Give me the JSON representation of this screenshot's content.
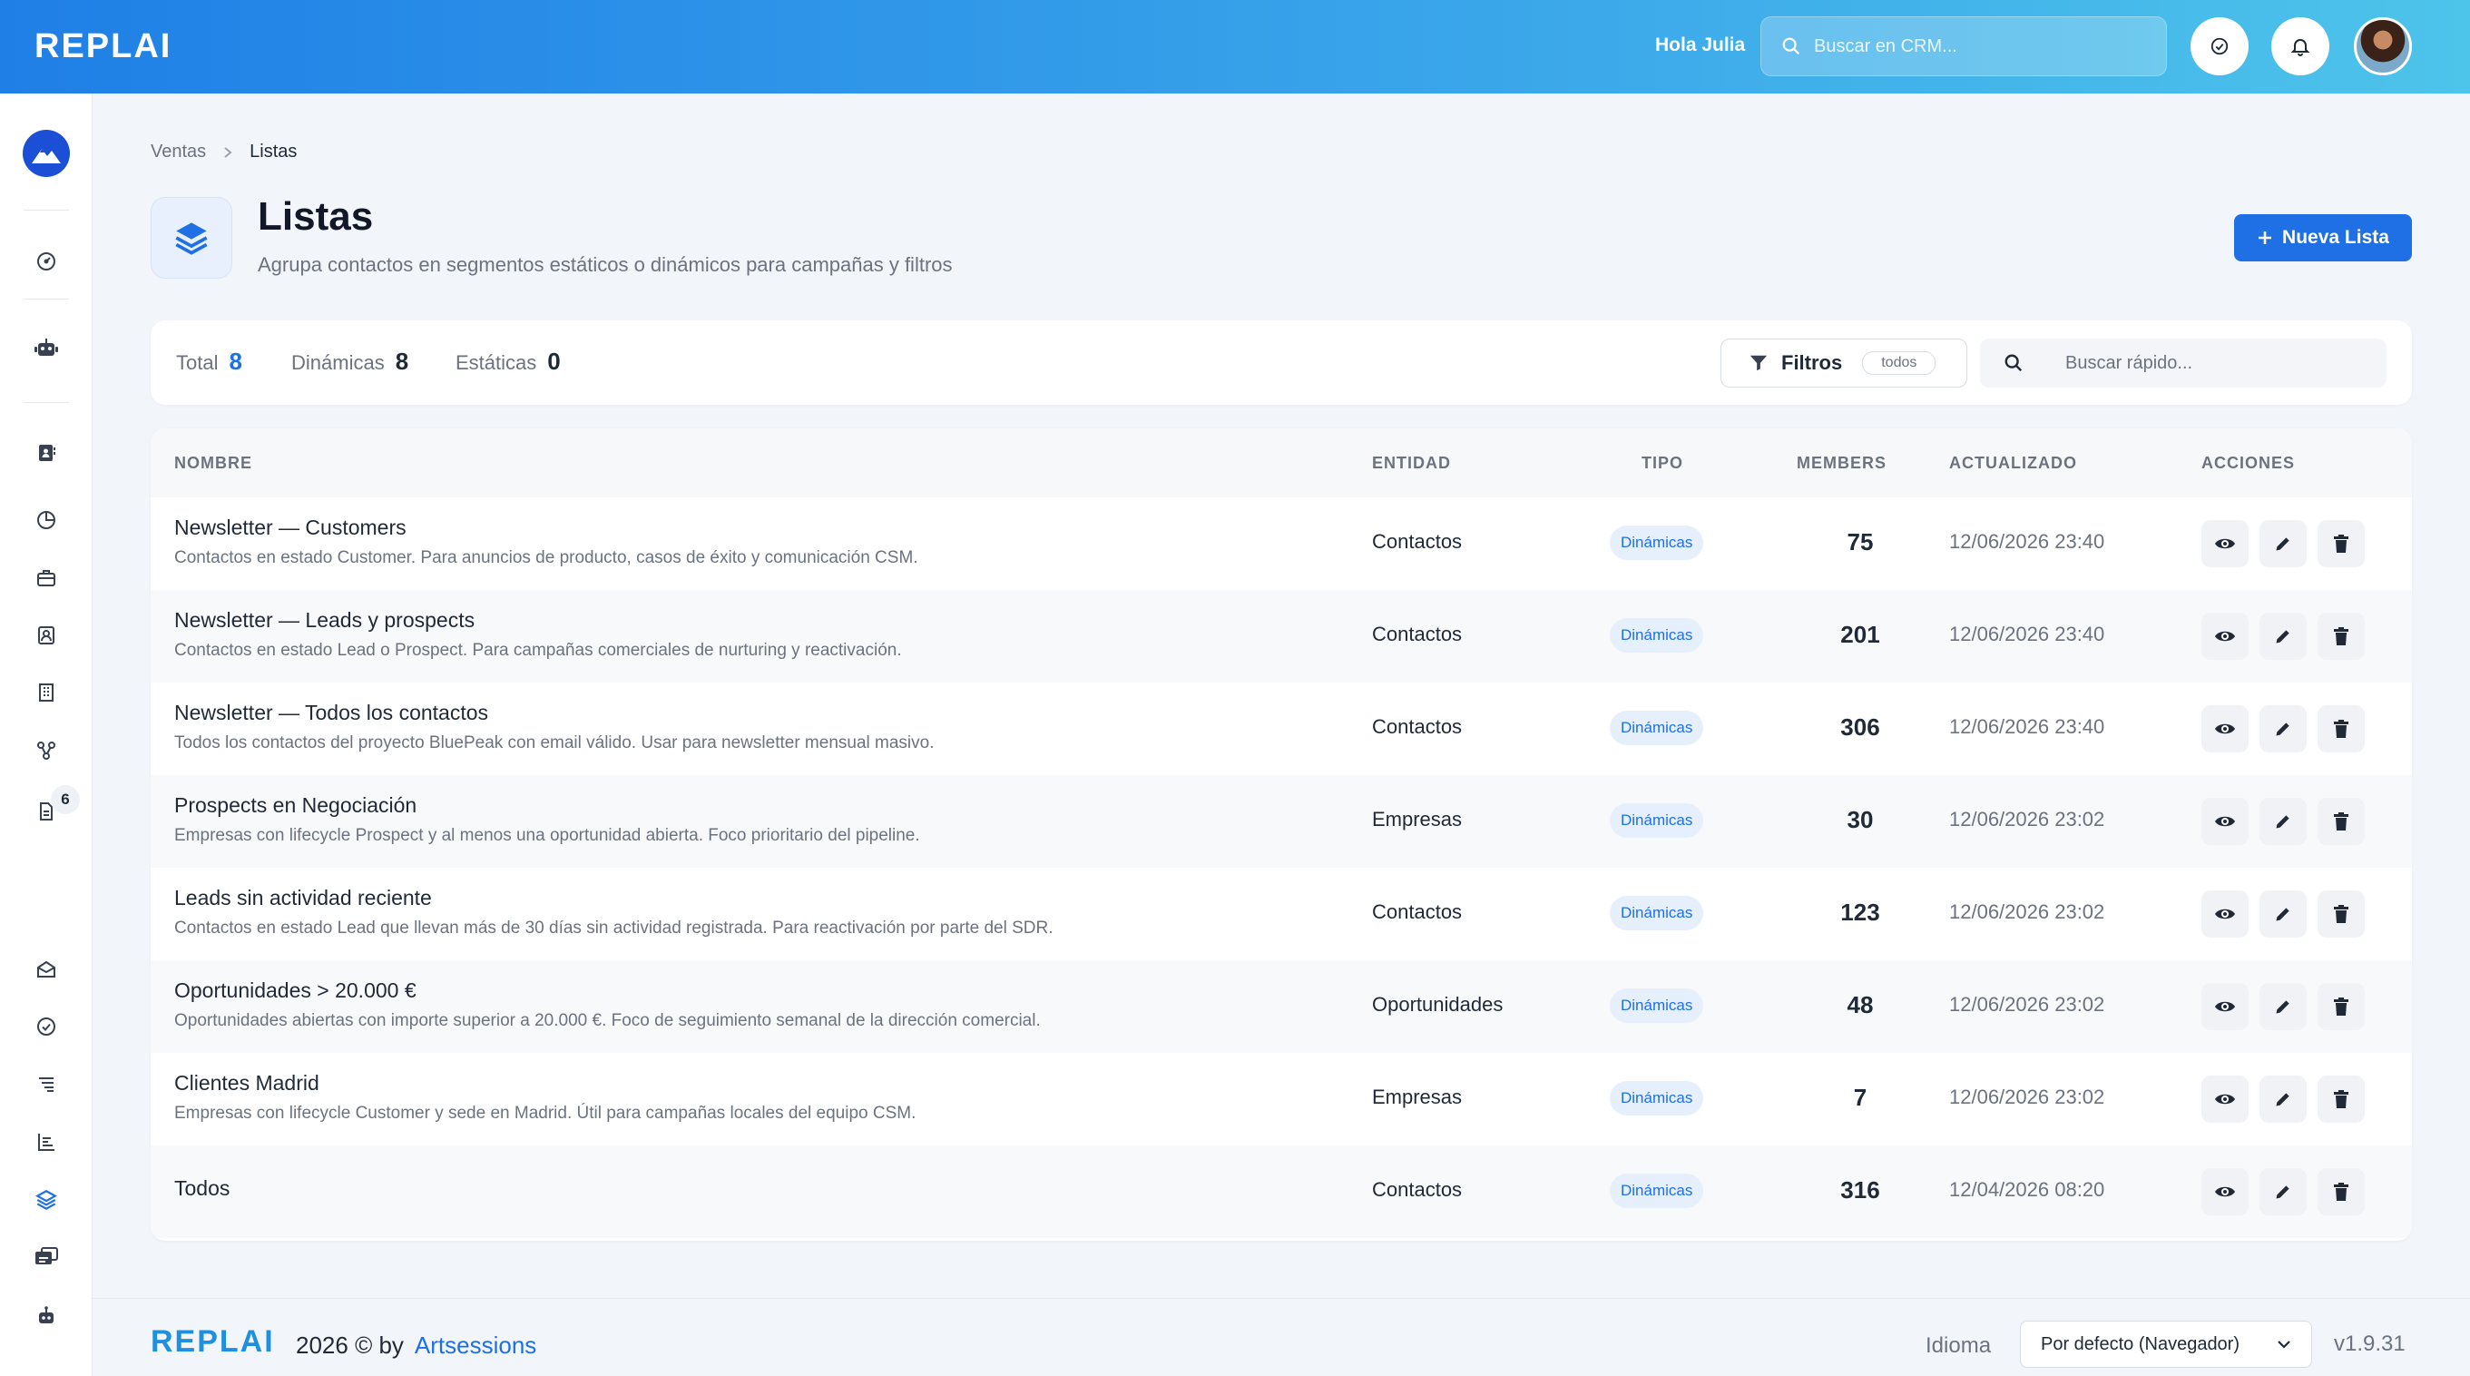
{
  "app": {
    "logo": "REPLAI",
    "greeting": "Hola Julia",
    "search_placeholder": "Buscar en CRM..."
  },
  "sidebar": {
    "badge": "6",
    "icons": [
      "dashboard-icon",
      "robot-icon",
      "contacts-book-icon",
      "pie-chart-icon",
      "briefcase-icon",
      "contact-card-icon",
      "building-icon",
      "flow-icon",
      "document-icon",
      "envelope-open-icon",
      "check-circle-icon",
      "list-icon",
      "bar-list-icon",
      "layers-icon",
      "inbox-cards-icon",
      "bot-icon"
    ]
  },
  "breadcrumb": {
    "parent": "Ventas",
    "current": "Listas"
  },
  "page": {
    "title": "Listas",
    "subtitle": "Agrupa contactos en segmentos estáticos o dinámicos para campañas y filtros",
    "new_button": "Nueva Lista"
  },
  "stats": {
    "total_label": "Total",
    "total": "8",
    "dyn_label": "Dinámicas",
    "dyn": "8",
    "static_label": "Estáticas",
    "static": "0"
  },
  "filters": {
    "label": "Filtros",
    "pill": "todos",
    "quick_placeholder": "Buscar rápido..."
  },
  "table": {
    "headers": {
      "name": "NOMBRE",
      "entity": "ENTIDAD",
      "type": "TIPO",
      "members": "MEMBERS",
      "updated": "ACTUALIZADO",
      "actions": "ACCIONES"
    },
    "rows": [
      {
        "name": "Newsletter — Customers",
        "desc": "Contactos en estado Customer. Para anuncios de producto, casos de éxito y comunicación CSM.",
        "entity": "Contactos",
        "type": "Dinámicas",
        "members": "75",
        "updated": "12/06/2026 23:40"
      },
      {
        "name": "Newsletter — Leads y prospects",
        "desc": "Contactos en estado Lead o Prospect. Para campañas comerciales de nurturing y reactivación.",
        "entity": "Contactos",
        "type": "Dinámicas",
        "members": "201",
        "updated": "12/06/2026 23:40"
      },
      {
        "name": "Newsletter — Todos los contactos",
        "desc": "Todos los contactos del proyecto BluePeak con email válido. Usar para newsletter mensual masivo.",
        "entity": "Contactos",
        "type": "Dinámicas",
        "members": "306",
        "updated": "12/06/2026 23:40"
      },
      {
        "name": "Prospects en Negociación",
        "desc": "Empresas con lifecycle Prospect y al menos una oportunidad abierta. Foco prioritario del pipeline.",
        "entity": "Empresas",
        "type": "Dinámicas",
        "members": "30",
        "updated": "12/06/2026 23:02"
      },
      {
        "name": "Leads sin actividad reciente",
        "desc": "Contactos en estado Lead que llevan más de 30 días sin actividad registrada. Para reactivación por parte del SDR.",
        "entity": "Contactos",
        "type": "Dinámicas",
        "members": "123",
        "updated": "12/06/2026 23:02"
      },
      {
        "name": "Oportunidades > 20.000 €",
        "desc": "Oportunidades abiertas con importe superior a 20.000 €. Foco de seguimiento semanal de la dirección comercial.",
        "entity": "Oportunidades",
        "type": "Dinámicas",
        "members": "48",
        "updated": "12/06/2026 23:02"
      },
      {
        "name": "Clientes Madrid",
        "desc": "Empresas con lifecycle Customer y sede en Madrid. Útil para campañas locales del equipo CSM.",
        "entity": "Empresas",
        "type": "Dinámicas",
        "members": "7",
        "updated": "12/06/2026 23:02"
      },
      {
        "name": "Todos",
        "desc": "",
        "entity": "Contactos",
        "type": "Dinámicas",
        "members": "316",
        "updated": "12/04/2026 08:20"
      }
    ]
  },
  "footer": {
    "logo": "REPLAI",
    "copy": "2026 © by",
    "author": "Artsessions",
    "lang_label": "Idioma",
    "lang_value": "Por defecto (Navegador)",
    "version": "v1.9.31"
  },
  "colors": {
    "primary": "#1f6fe5",
    "header_gradient_start": "#1f7fe6",
    "header_gradient_end": "#4dc4ea"
  }
}
